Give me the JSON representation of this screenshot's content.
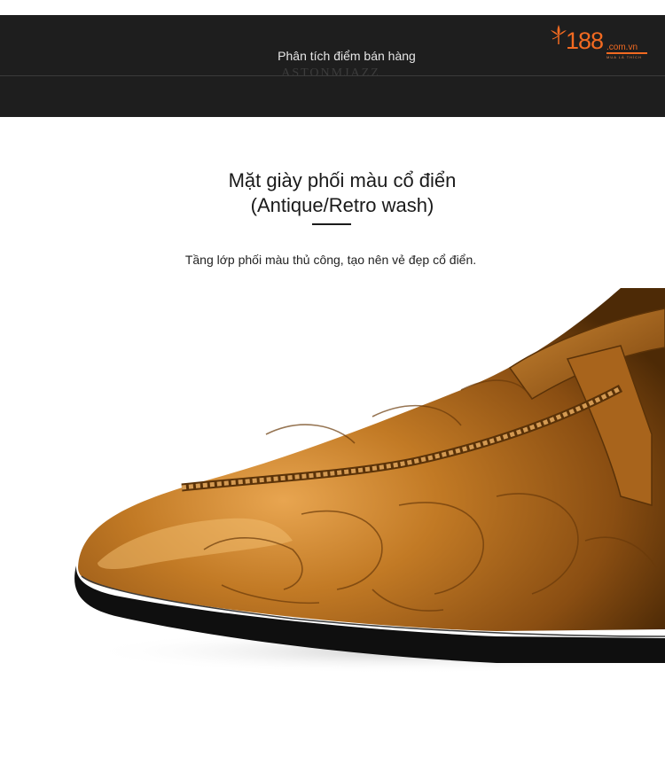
{
  "header": {
    "title": "Phân tích điểm bán hàng",
    "brand_watermark": "ASTONMJAZZ"
  },
  "logo": {
    "number": "188",
    "domain": ".com.vn",
    "tagline": "MUA LÀ THÍCH"
  },
  "section": {
    "title_line1": "Mặt giày phối màu cổ điển",
    "title_line2": "(Antique/Retro wash)",
    "description": "Tầng lớp phối màu thủ công, tạo nên vẻ đẹp cổ điển."
  },
  "colors": {
    "header_bg": "#1e1e1e",
    "logo_orange": "#f26a21",
    "leather_tan": "#b8741e",
    "leather_dark": "#5a3208"
  },
  "image": {
    "subject": "shoe-photo"
  }
}
